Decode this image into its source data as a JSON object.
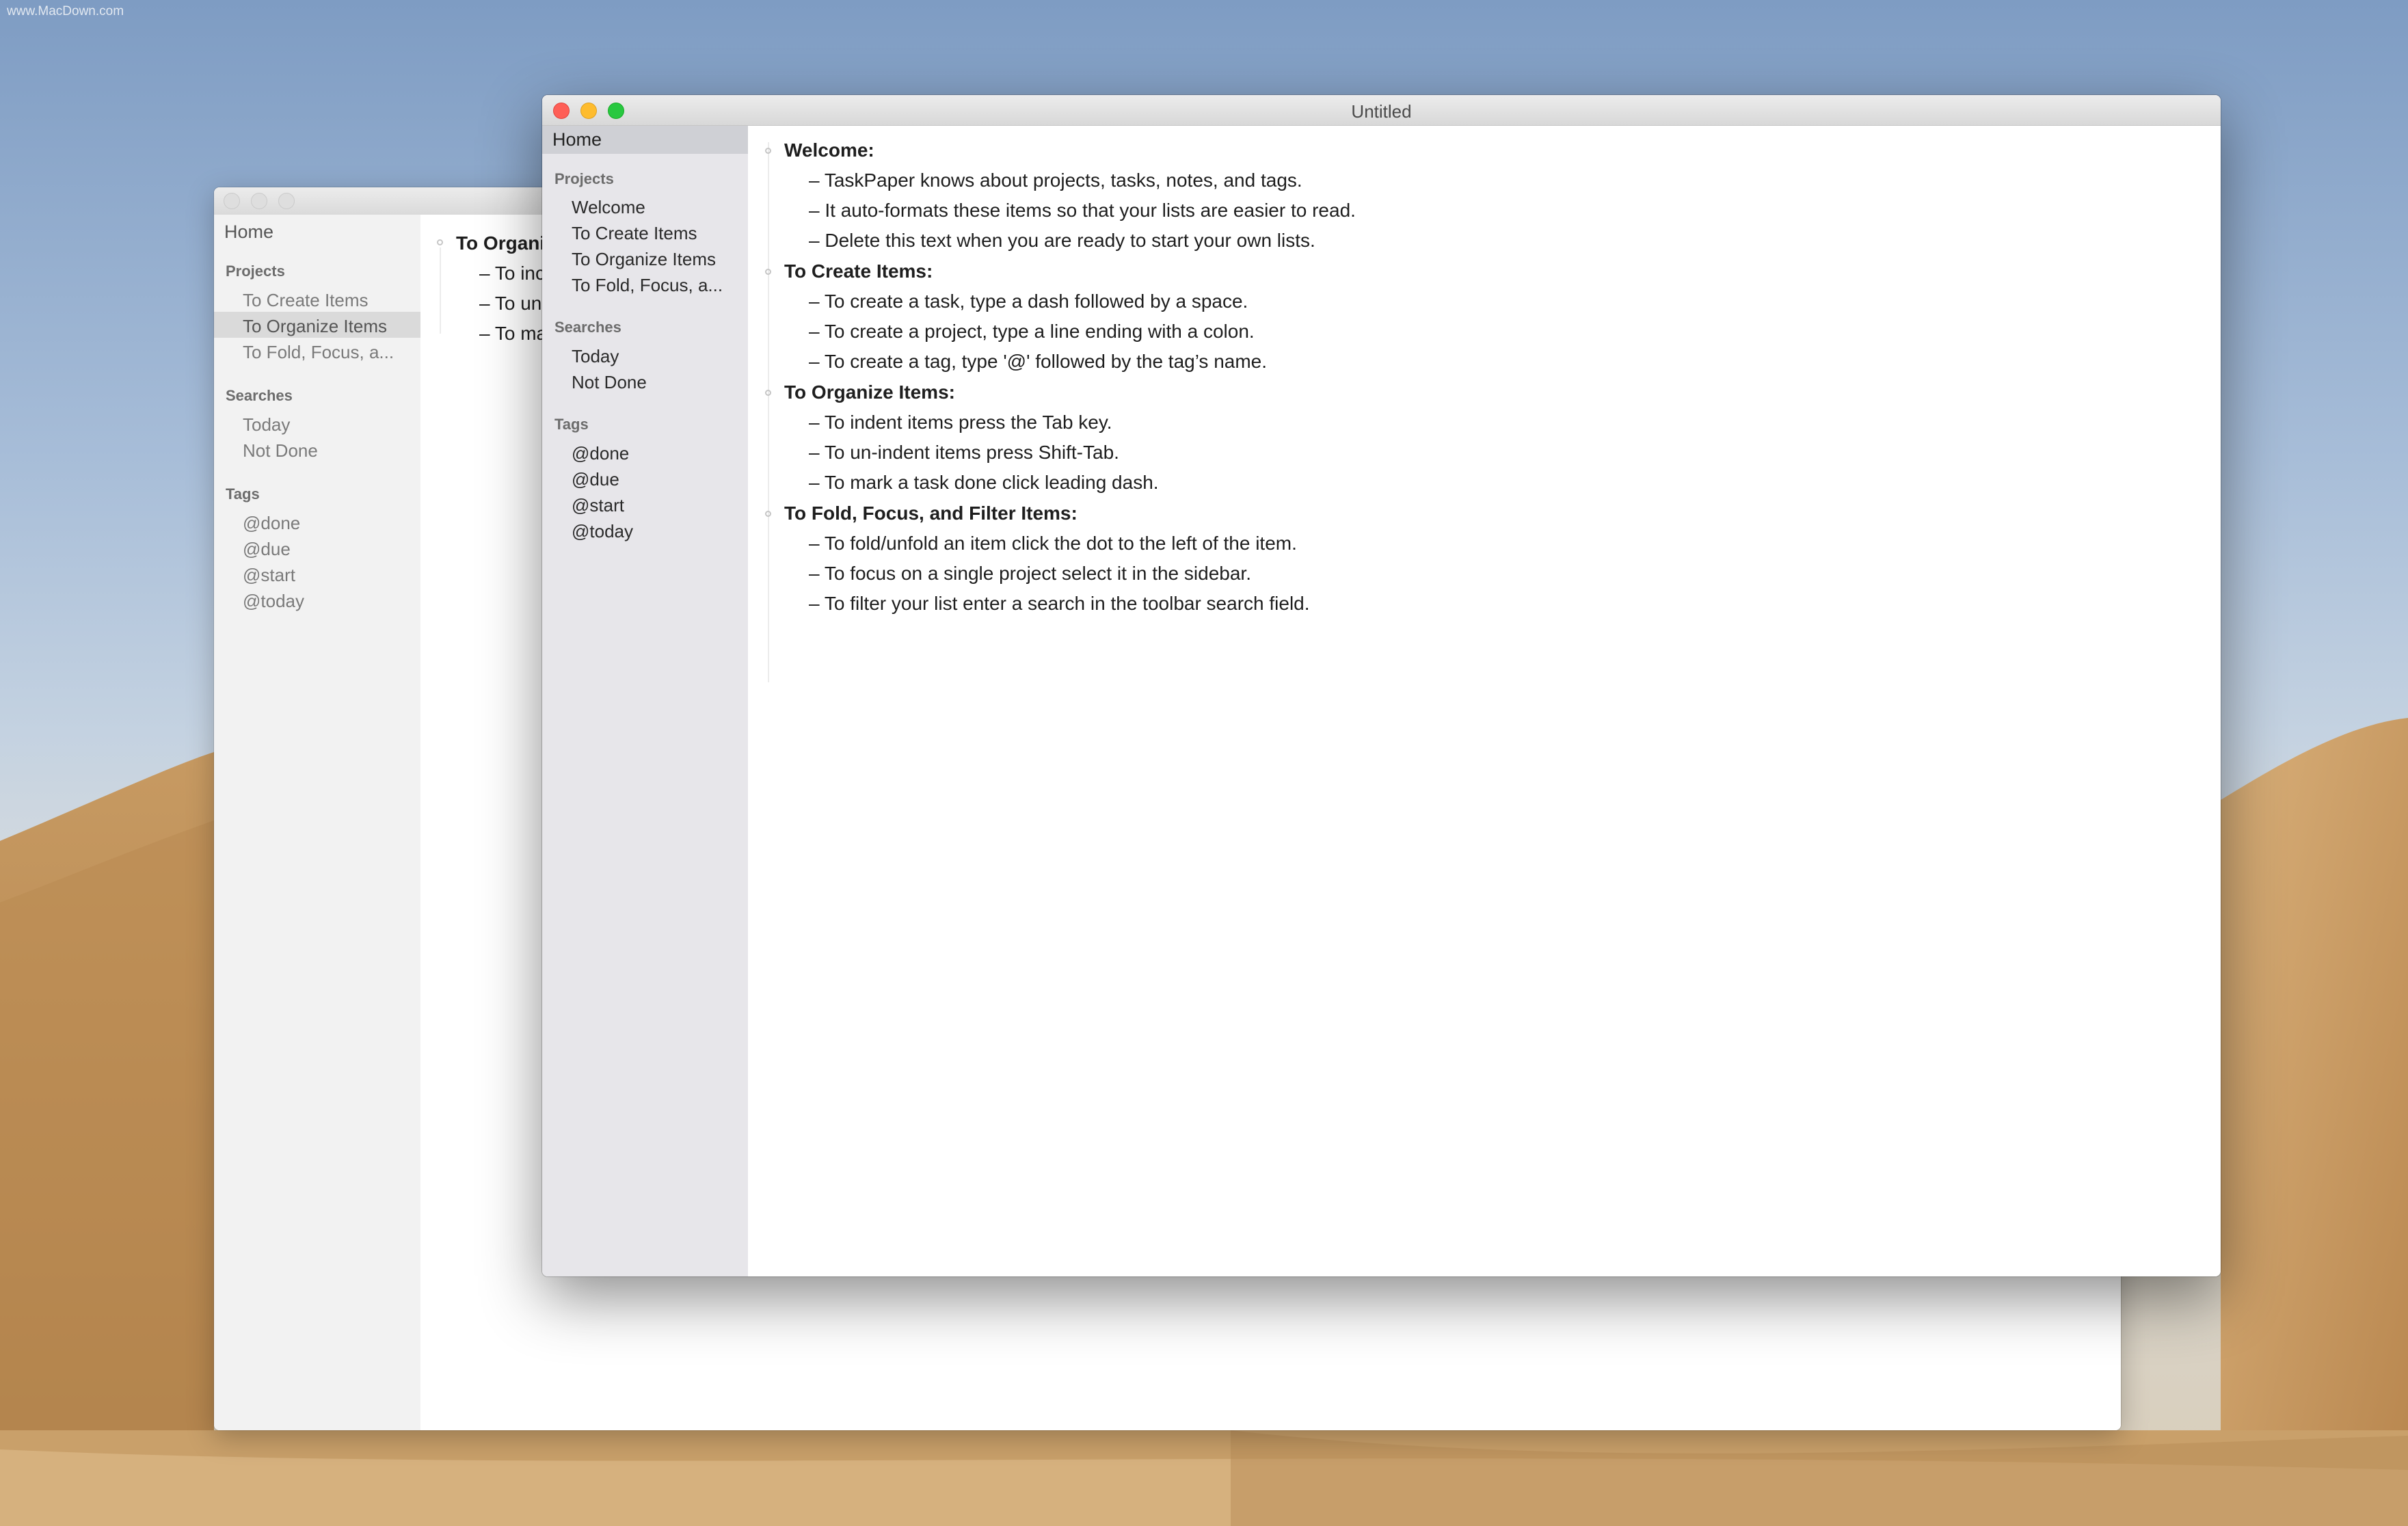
{
  "watermark": "www.MacDown.com",
  "front_window": {
    "title": "Untitled",
    "sidebar": {
      "home": "Home",
      "projects_heading": "Projects",
      "projects": [
        "Welcome",
        "To Create Items",
        "To Organize Items",
        "To Fold, Focus, a..."
      ],
      "searches_heading": "Searches",
      "searches": [
        "Today",
        "Not Done"
      ],
      "tags_heading": "Tags",
      "tags": [
        "@done",
        "@due",
        "@start",
        "@today"
      ]
    },
    "outline": [
      {
        "project": "Welcome:",
        "tasks": [
          "– TaskPaper knows about projects, tasks, notes, and tags.",
          "– It auto-formats these items so that your lists are easier to read.",
          "– Delete this text when you are ready to start your own lists."
        ]
      },
      {
        "project": "To Create Items:",
        "tasks": [
          "– To create a task, type a dash followed by a space.",
          "– To create a project, type a line ending with a colon.",
          "– To create a tag, type '@' followed by the tag’s name."
        ]
      },
      {
        "project": "To Organize Items:",
        "tasks": [
          "– To indent items press the Tab key.",
          "– To un-indent items press Shift-Tab.",
          "– To mark a task done click leading dash."
        ]
      },
      {
        "project": "To Fold, Focus, and Filter Items:",
        "tasks": [
          "– To fold/unfold an item click the dot to the left of the item.",
          "– To focus on a single project select it in the sidebar.",
          "– To filter your list enter a search in the toolbar search field."
        ]
      }
    ]
  },
  "back_window": {
    "sidebar": {
      "home": "Home",
      "projects_heading": "Projects",
      "projects": [
        "To Create Items",
        "To Organize Items",
        "To Fold, Focus, a..."
      ],
      "selected_project": "To Organize Items",
      "searches_heading": "Searches",
      "searches": [
        "Today",
        "Not Done"
      ],
      "tags_heading": "Tags",
      "tags": [
        "@done",
        "@due",
        "@start",
        "@today"
      ]
    },
    "outline": {
      "project": "To Organi",
      "tasks": [
        "– To inc",
        "– To un",
        "– To ma"
      ]
    }
  },
  "colors": {
    "close": "#fe5f57",
    "minimize": "#febc2e",
    "zoom": "#28c840",
    "sidebar_selection": "#cfd0d5"
  }
}
